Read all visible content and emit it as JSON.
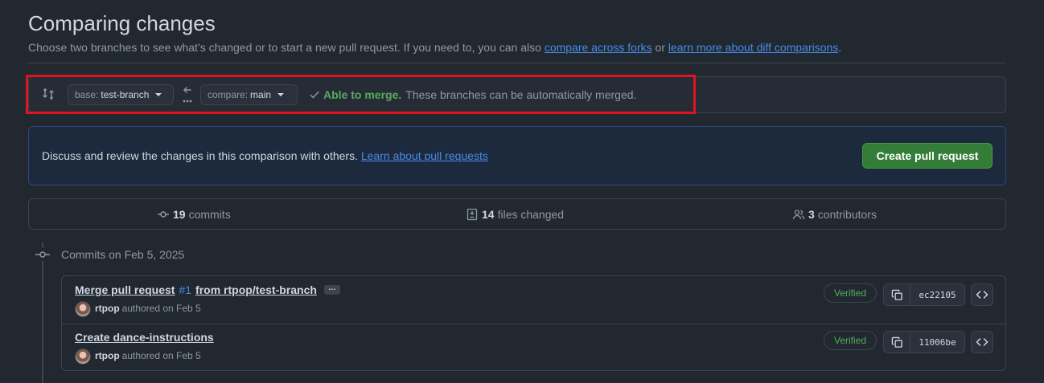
{
  "header": {
    "title": "Comparing changes",
    "subtitle_prefix": "Choose two branches to see what’s changed or to start a new pull request. If you need to, you can also ",
    "link_forks": "compare across forks",
    "subtitle_or": " or ",
    "link_learn_diff": "learn more about diff comparisons",
    "subtitle_end": "."
  },
  "range": {
    "base_prefix": "base:",
    "base_value": "test-branch",
    "compare_prefix": "compare:",
    "compare_value": "main",
    "merge_ok": "Able to merge.",
    "merge_msg": "These branches can be automatically merged."
  },
  "pr": {
    "text": "Discuss and review the changes in this comparison with others. ",
    "link": "Learn about pull requests",
    "button": "Create pull request"
  },
  "stats": {
    "commits_num": "19",
    "commits_label": "commits",
    "files_num": "14",
    "files_label": "files changed",
    "contributors_num": "3",
    "contributors_label": "contributors"
  },
  "commits_date": "Commits on Feb 5, 2025",
  "commits": [
    {
      "title_a": "Merge pull request",
      "pr_number": "#1",
      "title_b": "from rtpop/test-branch",
      "ellipsis": "…",
      "author": "rtpop",
      "meta": "authored on Feb 5",
      "badge": "Verified",
      "sha": "ec22105"
    },
    {
      "title": "Create dance-instructions",
      "author": "rtpop",
      "meta": "authored on Feb 5",
      "badge": "Verified",
      "sha": "11006be"
    }
  ],
  "colors": {
    "background": "#212830",
    "accent_link": "#478be6",
    "success": "#57ab5a",
    "primary_button": "#347d39",
    "highlight_box": "#e0141e"
  }
}
